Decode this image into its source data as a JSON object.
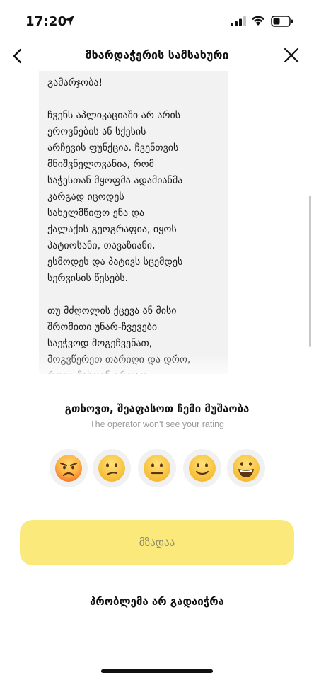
{
  "status_bar": {
    "time": "17:20",
    "icons": [
      "location-arrow-icon",
      "cell-signal-icon",
      "wifi-icon",
      "battery-icon"
    ]
  },
  "header": {
    "title": "მხარდაჭერის სამსახური",
    "back_icon": "chevron-left-icon",
    "close_icon": "close-icon"
  },
  "chat": {
    "message": "გამარჯობა!\n\nჩვენს აპლიკაციაში არ არის\nეროვნების ან სქესის\nარჩევის ფუნქცია. ჩვენთვის\nმნიშვნელოვანია, რომ\nსაჭესთან მყოფმა ადამიანმა\nკარგად იცოდეს\nსახელმწიფო ენა და\nქალაქის გეოგრაფია, იყოს\nპატიოსანი, თავაზიანი,\nესმოდეს და პატივს სცემდეს\nსერვისის წესებს.\n\nთუ მძღოლის ქცევა ან მისი\nშრომითი უნარ-ჩვევები\nსაეჭვოდ მოგეჩვენათ,\nმოგვწერეთ თარიღი და დრო,\nროცა მასთან ერთად\nიმგზავრეთ."
  },
  "rating": {
    "title": "გთხოვთ, შეაფასოთ ჩემი მუშაობა",
    "subtitle": "The operator won't see your rating",
    "emojis": [
      "angry-face-icon",
      "confused-face-icon",
      "neutral-face-icon",
      "slightly-smiling-face-icon",
      "grinning-face-icon"
    ],
    "submit_label": "მზადაა",
    "no_problem_label": "პრობლემა არ გადაიჭრა"
  },
  "colors": {
    "submit_bg": "#fbea7b",
    "bubble_bg": "#f2f2f2",
    "emoji_yellow": "#ffcc33"
  }
}
